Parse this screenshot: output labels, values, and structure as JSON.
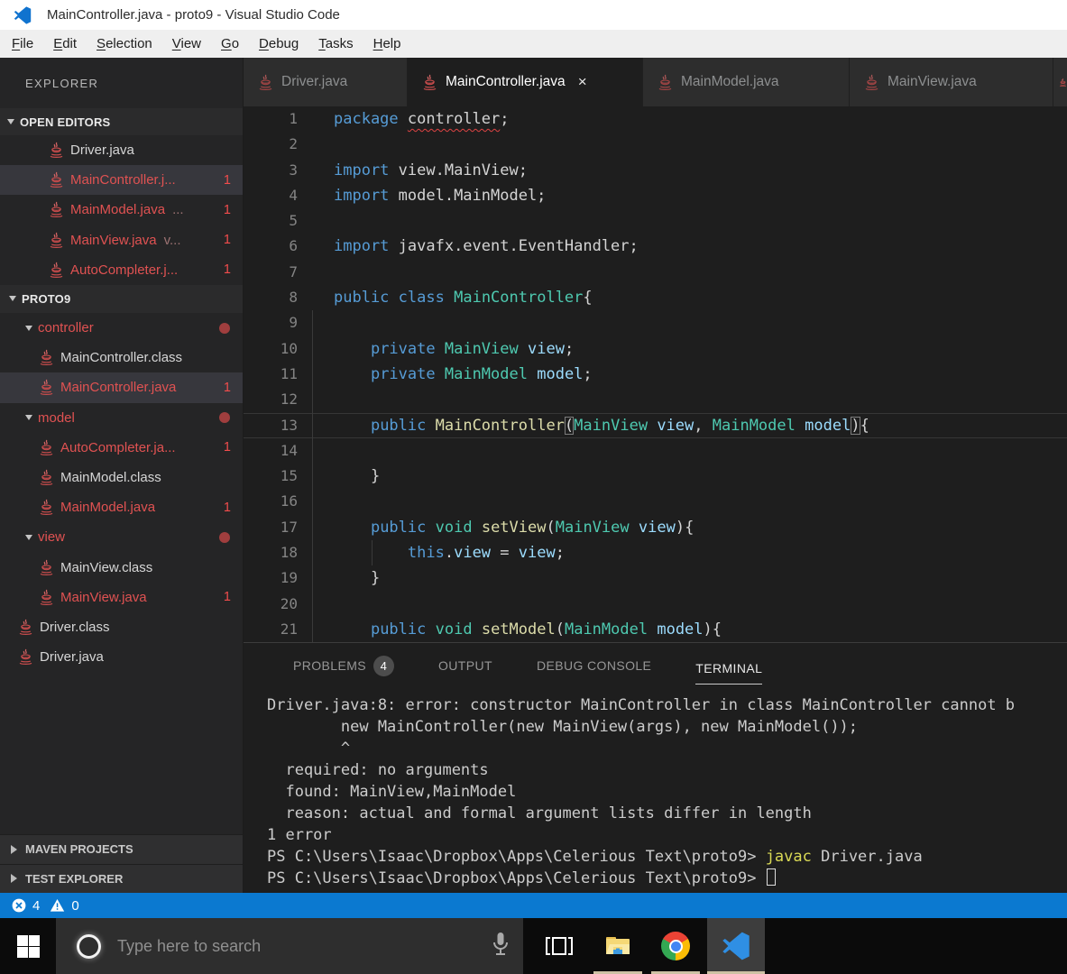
{
  "window": {
    "title": "MainController.java - proto9 - Visual Studio Code"
  },
  "menu": {
    "items": [
      "File",
      "Edit",
      "Selection",
      "View",
      "Go",
      "Debug",
      "Tasks",
      "Help"
    ]
  },
  "sidebar": {
    "title": "EXPLORER",
    "open_editors": {
      "header": "OPEN EDITORS",
      "items": [
        {
          "label": "Driver.java"
        },
        {
          "label": "MainController.j...",
          "error": true,
          "badge": "1",
          "selected": true
        },
        {
          "label": "MainModel.java",
          "desc": "...",
          "error": true,
          "badge": "1"
        },
        {
          "label": "MainView.java",
          "desc": "v...",
          "error": true,
          "badge": "1"
        },
        {
          "label": "AutoCompleter.j...",
          "error": true,
          "badge": "1"
        }
      ]
    },
    "project": {
      "header": "PROTO9",
      "items": [
        {
          "label": "controller",
          "type": "folder",
          "error": true,
          "dot": true,
          "indent": 1
        },
        {
          "label": "MainController.class",
          "type": "file",
          "indent": 2
        },
        {
          "label": "MainController.java",
          "type": "file",
          "error": true,
          "badge": "1",
          "selected": true,
          "indent": 2
        },
        {
          "label": "model",
          "type": "folder",
          "error": true,
          "dot": true,
          "indent": 1
        },
        {
          "label": "AutoCompleter.ja...",
          "type": "file",
          "error": true,
          "badge": "1",
          "indent": 2
        },
        {
          "label": "MainModel.class",
          "type": "file",
          "indent": 2
        },
        {
          "label": "MainModel.java",
          "type": "file",
          "error": true,
          "badge": "1",
          "indent": 2
        },
        {
          "label": "view",
          "type": "folder",
          "error": true,
          "dot": true,
          "indent": 1
        },
        {
          "label": "MainView.class",
          "type": "file",
          "indent": 2
        },
        {
          "label": "MainView.java",
          "type": "file",
          "error": true,
          "badge": "1",
          "indent": 2
        },
        {
          "label": "Driver.class",
          "type": "file",
          "indent": 1
        },
        {
          "label": "Driver.java",
          "type": "file",
          "indent": 1
        }
      ]
    },
    "bottom_sections": [
      "MAVEN PROJECTS",
      "TEST EXPLORER"
    ]
  },
  "tabs": [
    {
      "label": "Driver.java",
      "active": false
    },
    {
      "label": "MainController.java",
      "active": true,
      "close": "×"
    },
    {
      "label": "MainModel.java",
      "active": false
    },
    {
      "label": "MainView.java",
      "active": false
    }
  ],
  "editor": {
    "lines": [
      {
        "n": "1",
        "tk": [
          [
            "package",
            "kw"
          ],
          [
            " ",
            ""
          ],
          [
            "controller",
            "sq"
          ],
          [
            ";",
            ""
          ]
        ]
      },
      {
        "n": "2",
        "tk": []
      },
      {
        "n": "3",
        "tk": [
          [
            "import",
            "kw"
          ],
          [
            " view.MainView;",
            ""
          ]
        ]
      },
      {
        "n": "4",
        "tk": [
          [
            "import",
            "kw"
          ],
          [
            " model.MainModel;",
            ""
          ]
        ]
      },
      {
        "n": "5",
        "tk": []
      },
      {
        "n": "6",
        "tk": [
          [
            "import",
            "kw"
          ],
          [
            " javafx.event.EventHandler;",
            ""
          ]
        ]
      },
      {
        "n": "7",
        "tk": []
      },
      {
        "n": "8",
        "tk": [
          [
            "public",
            "kw"
          ],
          [
            " ",
            ""
          ],
          [
            "class",
            "kw"
          ],
          [
            " ",
            ""
          ],
          [
            "MainController",
            "type"
          ],
          [
            "{",
            ""
          ]
        ]
      },
      {
        "n": "9",
        "tk": [],
        "g": [
          0
        ]
      },
      {
        "n": "10",
        "tk": [
          [
            "    ",
            ""
          ],
          [
            "private",
            "kw"
          ],
          [
            " ",
            ""
          ],
          [
            "MainView",
            "type"
          ],
          [
            " ",
            ""
          ],
          [
            "view",
            "var"
          ],
          [
            ";",
            ""
          ]
        ],
        "g": [
          0
        ]
      },
      {
        "n": "11",
        "tk": [
          [
            "    ",
            ""
          ],
          [
            "private",
            "kw"
          ],
          [
            " ",
            ""
          ],
          [
            "MainModel",
            "type"
          ],
          [
            " ",
            ""
          ],
          [
            "model",
            "var"
          ],
          [
            ";",
            ""
          ]
        ],
        "g": [
          0
        ]
      },
      {
        "n": "12",
        "tk": [],
        "g": [
          0
        ]
      },
      {
        "n": "13",
        "tk": [
          [
            "    ",
            ""
          ],
          [
            "public",
            "kw"
          ],
          [
            " ",
            ""
          ],
          [
            "MainController",
            "fn"
          ],
          [
            "(",
            "bm"
          ],
          [
            "MainView",
            "type"
          ],
          [
            " ",
            ""
          ],
          [
            "view",
            "var"
          ],
          [
            ", ",
            ""
          ],
          [
            "MainModel",
            "type"
          ],
          [
            " ",
            ""
          ],
          [
            "model",
            "var"
          ],
          [
            ")",
            "bm"
          ],
          [
            "{",
            ""
          ]
        ],
        "g": [
          0
        ],
        "cur": true
      },
      {
        "n": "14",
        "tk": [],
        "g": [
          0
        ]
      },
      {
        "n": "15",
        "tk": [
          [
            "    }",
            ""
          ]
        ],
        "g": [
          0
        ]
      },
      {
        "n": "16",
        "tk": [],
        "g": [
          0
        ]
      },
      {
        "n": "17",
        "tk": [
          [
            "    ",
            ""
          ],
          [
            "public",
            "kw"
          ],
          [
            " ",
            ""
          ],
          [
            "void",
            "kw2"
          ],
          [
            " ",
            ""
          ],
          [
            "setView",
            "fn"
          ],
          [
            "(",
            ""
          ],
          [
            "MainView",
            "type"
          ],
          [
            " ",
            ""
          ],
          [
            "view",
            "var"
          ],
          [
            "){",
            ""
          ]
        ],
        "g": [
          0
        ]
      },
      {
        "n": "18",
        "tk": [
          [
            "        ",
            ""
          ],
          [
            "this",
            "kw"
          ],
          [
            ".",
            ""
          ],
          [
            "view",
            "var"
          ],
          [
            " = ",
            ""
          ],
          [
            "view",
            "var"
          ],
          [
            ";",
            ""
          ]
        ],
        "g": [
          0,
          1
        ]
      },
      {
        "n": "19",
        "tk": [
          [
            "    }",
            ""
          ]
        ],
        "g": [
          0
        ]
      },
      {
        "n": "20",
        "tk": [],
        "g": [
          0
        ]
      },
      {
        "n": "21",
        "tk": [
          [
            "    ",
            ""
          ],
          [
            "public",
            "kw"
          ],
          [
            " ",
            ""
          ],
          [
            "void",
            "kw2"
          ],
          [
            " ",
            ""
          ],
          [
            "setModel",
            "fn"
          ],
          [
            "(",
            ""
          ],
          [
            "MainModel",
            "type"
          ],
          [
            " ",
            ""
          ],
          [
            "model",
            "var"
          ],
          [
            "){",
            ""
          ]
        ],
        "g": [
          0
        ]
      }
    ]
  },
  "panel": {
    "tabs": [
      {
        "label": "PROBLEMS",
        "badge": "4"
      },
      {
        "label": "OUTPUT"
      },
      {
        "label": "DEBUG CONSOLE"
      },
      {
        "label": "TERMINAL",
        "active": true
      }
    ],
    "terminal_lines": [
      {
        "s": [
          [
            "Driver.java:8: error: constructor MainController in class MainController cannot b",
            ""
          ]
        ]
      },
      {
        "s": [
          [
            "        new MainController(new MainView(args), new MainModel());",
            ""
          ]
        ]
      },
      {
        "s": [
          [
            "        ^",
            ""
          ]
        ]
      },
      {
        "s": [
          [
            "  required: no arguments",
            ""
          ]
        ]
      },
      {
        "s": [
          [
            "  found: MainView,MainModel",
            ""
          ]
        ]
      },
      {
        "s": [
          [
            "  reason: actual and formal argument lists differ in length",
            ""
          ]
        ]
      },
      {
        "s": [
          [
            "1 error",
            ""
          ]
        ]
      },
      {
        "s": [
          [
            "PS C:\\Users\\Isaac\\Dropbox\\Apps\\Celerious Text\\proto9> ",
            ""
          ],
          [
            "javac",
            "y"
          ],
          [
            " Driver.java",
            ""
          ]
        ]
      },
      {
        "s": [
          [
            "PS C:\\Users\\Isaac\\Dropbox\\Apps\\Celerious Text\\proto9> ",
            ""
          ]
        ],
        "cursor": true
      }
    ]
  },
  "status_bar": {
    "errors": "4",
    "warnings": "0"
  },
  "taskbar": {
    "search_placeholder": "Type here to search"
  },
  "colors": {
    "status_bar_bg": "#0b79d0",
    "error_red": "#f14c4c",
    "explorer_error_file": "#e05252",
    "keyword_blue": "#569cd6",
    "type_teal": "#4ec9b0",
    "function_yellow": "#dcdcaa",
    "variable_blue": "#9cdcfe",
    "terminal_command_yellow": "#dada55"
  }
}
